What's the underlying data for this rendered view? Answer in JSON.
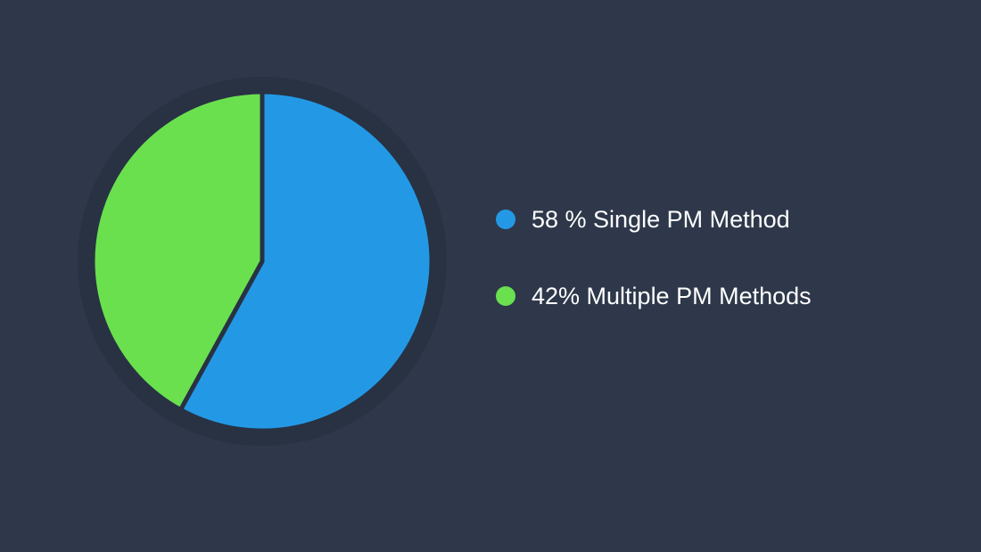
{
  "chart_data": {
    "type": "pie",
    "title": "",
    "slices": [
      {
        "label": "58 % Single PM Method",
        "value": 58,
        "color": "#2399e6"
      },
      {
        "label": "42% Multiple PM Methods",
        "value": 42,
        "color": "#6ae04f"
      }
    ],
    "legend_placement": "right",
    "background_color": "#2e384a",
    "ring_color": "#283243"
  }
}
